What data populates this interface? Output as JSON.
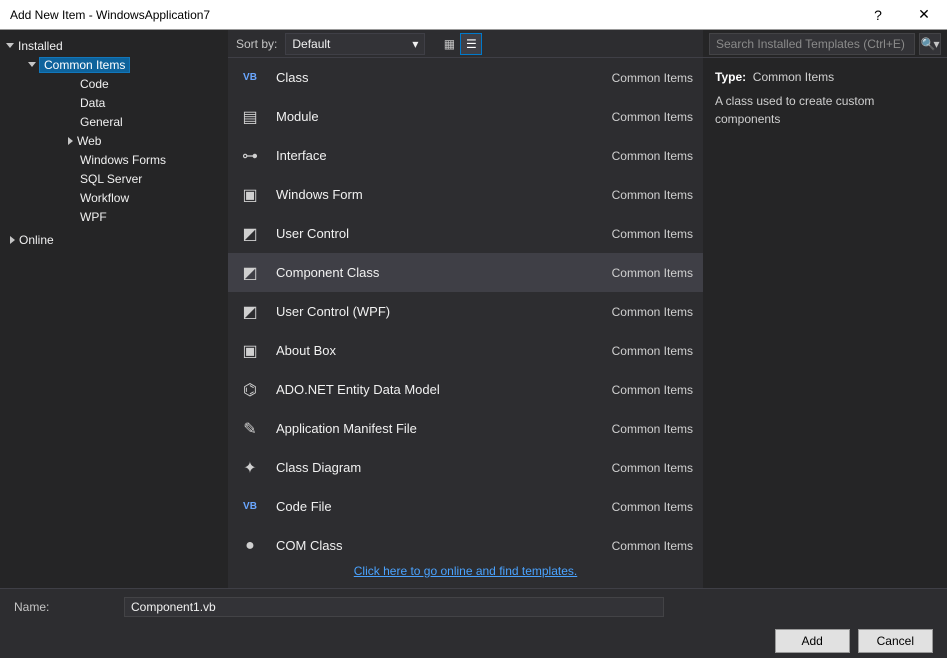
{
  "window": {
    "title": "Add New Item - WindowsApplication7",
    "help_glyph": "?",
    "close_glyph": "✕"
  },
  "nav": {
    "installed_label": "Installed",
    "common_items_label": "Common Items",
    "children": [
      {
        "label": "Code"
      },
      {
        "label": "Data"
      },
      {
        "label": "General"
      },
      {
        "label": "Web",
        "expandable": true
      },
      {
        "label": "Windows Forms"
      },
      {
        "label": "SQL Server"
      },
      {
        "label": "Workflow"
      },
      {
        "label": "WPF"
      }
    ],
    "online_label": "Online"
  },
  "toolbar": {
    "sort_label": "Sort by:",
    "sort_value": "Default"
  },
  "search": {
    "placeholder": "Search Installed Templates (Ctrl+E)"
  },
  "templates": [
    {
      "name": "Class",
      "category": "Common Items",
      "icon": "VB",
      "selected": false
    },
    {
      "name": "Module",
      "category": "Common Items",
      "icon": "▤",
      "selected": false
    },
    {
      "name": "Interface",
      "category": "Common Items",
      "icon": "⊶",
      "selected": false
    },
    {
      "name": "Windows Form",
      "category": "Common Items",
      "icon": "▣",
      "selected": false
    },
    {
      "name": "User Control",
      "category": "Common Items",
      "icon": "◩",
      "selected": false
    },
    {
      "name": "Component Class",
      "category": "Common Items",
      "icon": "◩",
      "selected": true
    },
    {
      "name": "User Control (WPF)",
      "category": "Common Items",
      "icon": "◩",
      "selected": false
    },
    {
      "name": "About Box",
      "category": "Common Items",
      "icon": "▣",
      "selected": false
    },
    {
      "name": "ADO.NET Entity Data Model",
      "category": "Common Items",
      "icon": "⌬",
      "selected": false
    },
    {
      "name": "Application Manifest File",
      "category": "Common Items",
      "icon": "✎",
      "selected": false
    },
    {
      "name": "Class Diagram",
      "category": "Common Items",
      "icon": "✦",
      "selected": false
    },
    {
      "name": "Code File",
      "category": "Common Items",
      "icon": "VB",
      "selected": false
    },
    {
      "name": "COM Class",
      "category": "Common Items",
      "icon": "●",
      "selected": false
    }
  ],
  "online_link": "Click here to go online and find templates.",
  "details": {
    "type_label": "Type:",
    "type_value": "Common Items",
    "description": "A class used to create custom components"
  },
  "footer": {
    "name_label": "Name:",
    "name_value": "Component1.vb",
    "add_label": "Add",
    "cancel_label": "Cancel"
  }
}
